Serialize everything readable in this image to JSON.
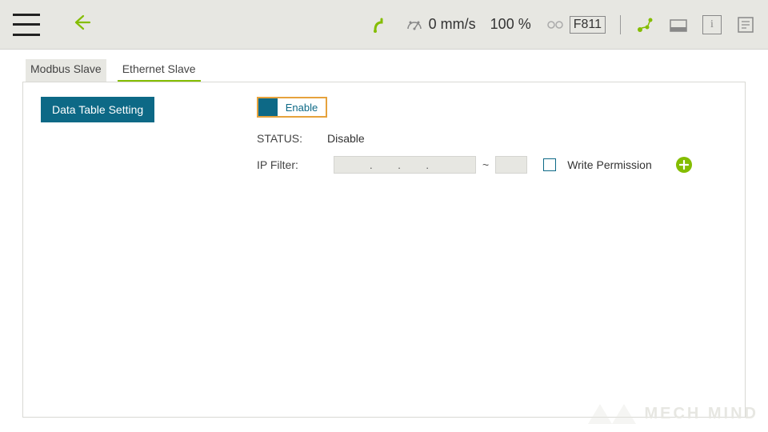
{
  "topbar": {
    "speed": "0 mm/s",
    "percent": "100 %",
    "code": "F811"
  },
  "tabs": {
    "modbus": "Modbus Slave",
    "ethernet": "Ethernet Slave"
  },
  "panel": {
    "data_table_btn": "Data Table Setting",
    "enable_label": "Enable",
    "status_label": "STATUS:",
    "status_value": "Disable",
    "ipfilter_label": "IP Filter:",
    "ip_sep": "~",
    "ip_placeholder": ".       .       .",
    "write_perm": "Write Permission"
  },
  "watermark": "MECH MIND"
}
